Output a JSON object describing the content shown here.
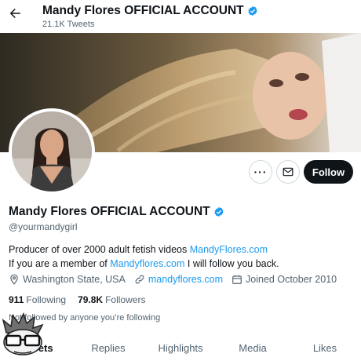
{
  "header": {
    "title": "Mandy Flores OFFICIAL ACCOUNT",
    "tweet_count": "21.1K Tweets"
  },
  "profile": {
    "display_name": "Mandy Flores OFFICIAL ACCOUNT",
    "handle": "@yourmandygirl",
    "bio_line1_text": "Producer of over 2000 adult fetish videos ",
    "bio_line1_link": "MandyFlores.com",
    "bio_line2_pre": "If you are a member of ",
    "bio_line2_link": "Mandyflores.com",
    "bio_line2_post": " I will follow you back.",
    "location": "Washington State, USA",
    "website": "mandyflores.com",
    "joined": "Joined October 2010",
    "following_count": "911",
    "following_label": "Following",
    "followers_count": "79.8K",
    "followers_label": "Followers",
    "followed_note": "Not followed by anyone you’re following"
  },
  "actions": {
    "more_label": "···",
    "follow_label": "Follow"
  },
  "tabs": [
    {
      "label": "Tweets",
      "active": true
    },
    {
      "label": "Replies",
      "active": false
    },
    {
      "label": "Highlights",
      "active": false
    },
    {
      "label": "Media",
      "active": false
    },
    {
      "label": "Likes",
      "active": false
    }
  ],
  "icons": {
    "back": "arrow-left-icon",
    "verified": "verified-badge-icon",
    "more": "more-horizontal-icon",
    "mail": "envelope-icon",
    "location": "location-pin-icon",
    "link": "link-icon",
    "calendar": "calendar-icon"
  },
  "colors": {
    "accent": "#1d9bf0",
    "text_primary": "#0f1419",
    "text_secondary": "#536471",
    "follow_button": "#0f1419"
  }
}
